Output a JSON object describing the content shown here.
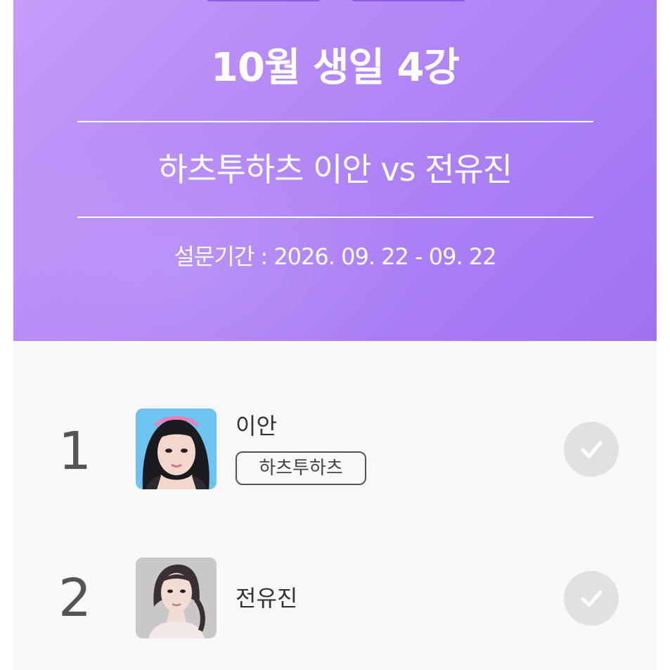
{
  "header": {
    "title": "10월 생일 4강",
    "matchup": "하츠투하츠 이안 vs 전유진",
    "period": "설문기간 : 2026. 09. 22 - 09. 22"
  },
  "candidates": [
    {
      "rank": "1",
      "name": "이안",
      "group": "하츠투하츠",
      "photo_icon": "portrait-photo",
      "vote_icon": "check-icon"
    },
    {
      "rank": "2",
      "name": "전유진",
      "photo_icon": "portrait-photo",
      "vote_icon": "check-icon"
    }
  ],
  "colors": {
    "banner_start": "#c79cf8",
    "banner_end": "#9f72f2",
    "vote_button": "#e1e1e1",
    "background": "#f8f8f8"
  }
}
